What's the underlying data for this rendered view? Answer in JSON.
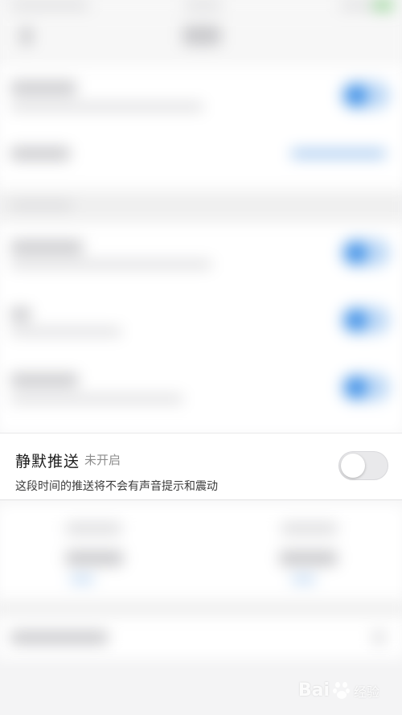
{
  "silent_push": {
    "title": "静默推送",
    "status": "未开启",
    "description": "这段时间的推送将不会有声音提示和震动",
    "toggle_on": false
  },
  "watermark": {
    "brand": "Bai",
    "brand_suffix": "经验"
  },
  "colors": {
    "accent": "#3d8fe6",
    "background": "#f4f4f5",
    "card": "#ffffff"
  }
}
